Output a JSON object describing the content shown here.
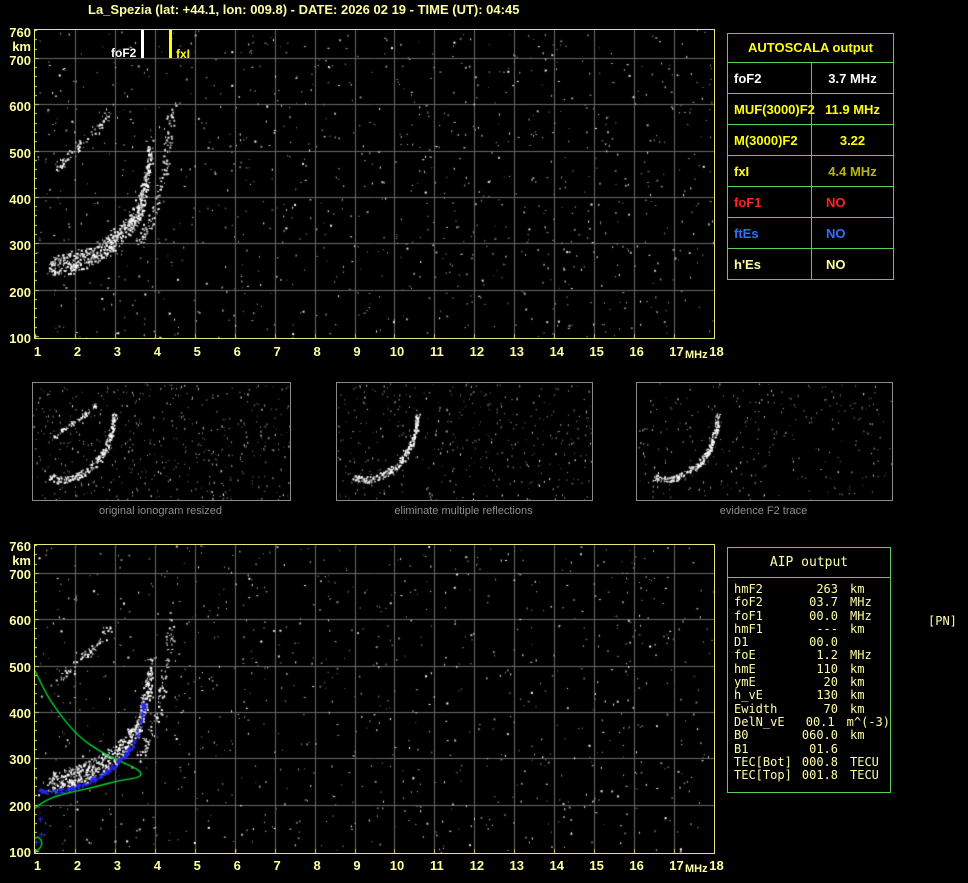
{
  "title": "La_Spezia (lat: +44.1, lon: 009.8) - DATE: 2026 02 19 - TIME (UT): 04:45",
  "colors": {
    "pale_yellow": "#ffffa0",
    "bright_yellow": "#ffff00",
    "olive": "#b8b800",
    "red": "#ff2222",
    "blue": "#2a72ff",
    "white": "#ffffff",
    "grid": "#686868",
    "plot_border": "#e6e67a",
    "table_green": "#58d058",
    "caption_gray": "#8f8f8f",
    "profile_green": "#00d435",
    "trace_blue": "#2626f5"
  },
  "axes": {
    "y_labels": [
      "760",
      "km",
      "700",
      "600",
      "500",
      "400",
      "300",
      "200",
      "100"
    ],
    "x_ticks": [
      "1",
      "2",
      "3",
      "4",
      "5",
      "6",
      "7",
      "8",
      "9",
      "10",
      "11",
      "12",
      "13",
      "14",
      "15",
      "16",
      "17",
      "18"
    ],
    "x_unit": "MHz"
  },
  "autoscala": {
    "header": "AUTOSCALA output",
    "rows": [
      {
        "label": "foF2",
        "value": "3.7 MHz",
        "label_color": "#ffffff",
        "value_color": "#ffffff"
      },
      {
        "label": "MUF(3000)F2",
        "value": "11.9 MHz",
        "label_color": "#ffff00",
        "value_color": "#ffff00"
      },
      {
        "label": "M(3000)F2",
        "value": "3.22",
        "label_color": "#ffff00",
        "value_color": "#ffff00"
      },
      {
        "label": "fxI",
        "value": "4.4 MHz",
        "label_color": "#ffff00",
        "value_color": "#b8b800"
      },
      {
        "label": "foF1",
        "value": "NO",
        "label_color": "#ff2222",
        "value_color": "#ff2222"
      },
      {
        "label": "ftEs",
        "value": "NO",
        "label_color": "#2a72ff",
        "value_color": "#2a72ff"
      },
      {
        "label": "h'Es",
        "value": "NO",
        "label_color": "#ffffa0",
        "value_color": "#ffffa0"
      }
    ]
  },
  "aip": {
    "header": "AIP output",
    "pn_note": "[PN]",
    "rows": [
      {
        "label": "hmF2",
        "value": "263",
        "unit": "km"
      },
      {
        "label": "foF2",
        "value": "03.7",
        "unit": "MHz"
      },
      {
        "label": "foF1",
        "value": "00.0",
        "unit": "MHz"
      },
      {
        "label": "hmF1",
        "value": "---",
        "unit": "km"
      },
      {
        "label": "D1",
        "value": "00.0",
        "unit": ""
      },
      {
        "label": "foE",
        "value": "1.2",
        "unit": "MHz"
      },
      {
        "label": "hmE",
        "value": "110",
        "unit": "km"
      },
      {
        "label": "ymE",
        "value": "20",
        "unit": "km"
      },
      {
        "label": "h_vE",
        "value": "130",
        "unit": "km"
      },
      {
        "label": "Ewidth",
        "value": "70",
        "unit": "km"
      },
      {
        "label": "DelN_vE",
        "value": "00.1",
        "unit": "m^(-3)"
      },
      {
        "label": "B0",
        "value": "060.0",
        "unit": "km"
      },
      {
        "label": "B1",
        "value": "01.6",
        "unit": ""
      },
      {
        "label": "TEC[Bot]",
        "value": "000.8",
        "unit": "TECU"
      },
      {
        "label": "TEC[Top]",
        "value": "001.8",
        "unit": "TECU"
      }
    ]
  },
  "thumbnails": [
    {
      "caption": "original ionogram resized",
      "seed": 11,
      "noise": 520,
      "second_hop": true
    },
    {
      "caption": "eliminate multiple reflections",
      "seed": 22,
      "noise": 430,
      "second_hop": false
    },
    {
      "caption": "evidence F2 trace",
      "seed": 33,
      "noise": 300,
      "second_hop": false
    }
  ],
  "chart_data": [
    {
      "name": "top_ionogram",
      "type": "scatter",
      "xlabel": "MHz",
      "ylabel": "km",
      "xlim": [
        1,
        18
      ],
      "ylim": [
        100,
        760
      ],
      "grid": true,
      "seed": 7,
      "noise_count": 1050,
      "markers": [
        {
          "label": "foF2",
          "freq_mhz": 3.7,
          "color": "#ffffff"
        },
        {
          "label": "fxI",
          "freq_mhz": 4.4,
          "color": "#ffff00"
        }
      ],
      "traces": [
        {
          "name": "F2-ordinary-echo",
          "n": 300,
          "jx": 3,
          "jy": 7,
          "offsets": [
            0,
            -10
          ],
          "color": "#ffffff",
          "points": [
            [
              1.35,
              238
            ],
            [
              1.6,
              242
            ],
            [
              1.85,
              247
            ],
            [
              2.1,
              254
            ],
            [
              2.35,
              263
            ],
            [
              2.6,
              274
            ],
            [
              2.85,
              288
            ],
            [
              3.05,
              302
            ],
            [
              3.25,
              318
            ],
            [
              3.45,
              340
            ],
            [
              3.6,
              365
            ],
            [
              3.72,
              400
            ],
            [
              3.82,
              445
            ],
            [
              3.9,
              495
            ]
          ]
        },
        {
          "name": "F2-extraordinary-echo",
          "n": 110,
          "jx": 4,
          "jy": 9,
          "offsets": [
            0
          ],
          "color": "#e8e8e8",
          "points": [
            [
              3.55,
              295
            ],
            [
              3.75,
              325
            ],
            [
              3.95,
              365
            ],
            [
              4.1,
              405
            ],
            [
              4.2,
              450
            ],
            [
              4.3,
              505
            ],
            [
              4.38,
              560
            ],
            [
              4.44,
              605
            ]
          ]
        },
        {
          "name": "second-hop-echo",
          "n": 80,
          "jx": 3,
          "jy": 6,
          "offsets": [
            0
          ],
          "color": "#ffffff",
          "points": [
            [
              1.5,
              462
            ],
            [
              1.75,
              482
            ],
            [
              2.0,
              503
            ],
            [
              2.3,
              527
            ],
            [
              2.6,
              553
            ],
            [
              2.85,
              582
            ]
          ]
        }
      ]
    },
    {
      "name": "bottom_ionogram",
      "type": "scatter",
      "xlabel": "MHz",
      "ylabel": "km",
      "xlim": [
        1,
        18
      ],
      "ylim": [
        100,
        760
      ],
      "grid": true,
      "seed": 19,
      "noise_count": 950,
      "traces": [
        {
          "name": "F2-ordinary-echo",
          "n": 280,
          "jx": 3,
          "jy": 7,
          "offsets": [
            0,
            -10
          ],
          "color": "#ffffff",
          "points": [
            [
              1.35,
              238
            ],
            [
              1.6,
              242
            ],
            [
              1.85,
              247
            ],
            [
              2.1,
              254
            ],
            [
              2.35,
              263
            ],
            [
              2.6,
              274
            ],
            [
              2.85,
              288
            ],
            [
              3.05,
              302
            ],
            [
              3.25,
              318
            ],
            [
              3.45,
              340
            ],
            [
              3.6,
              365
            ],
            [
              3.72,
              400
            ],
            [
              3.82,
              445
            ],
            [
              3.9,
              495
            ]
          ]
        },
        {
          "name": "F2-extraordinary-echo",
          "n": 100,
          "jx": 4,
          "jy": 9,
          "offsets": [
            0
          ],
          "color": "#e8e8e8",
          "points": [
            [
              3.55,
              295
            ],
            [
              3.75,
              325
            ],
            [
              3.95,
              365
            ],
            [
              4.1,
              405
            ],
            [
              4.2,
              450
            ],
            [
              4.3,
              505
            ],
            [
              4.38,
              560
            ],
            [
              4.44,
              605
            ]
          ]
        },
        {
          "name": "second-hop-echo",
          "n": 70,
          "jx": 3,
          "jy": 6,
          "offsets": [
            0
          ],
          "color": "#ffffff",
          "points": [
            [
              1.5,
              462
            ],
            [
              1.75,
              482
            ],
            [
              2.0,
              503
            ],
            [
              2.3,
              527
            ],
            [
              2.6,
              553
            ],
            [
              2.85,
              582
            ]
          ]
        }
      ],
      "profile_lines": [
        {
          "name": "electron-density-profile-F",
          "points": [
            [
              0.9,
              508
            ],
            [
              1.2,
              450
            ],
            [
              1.6,
              396
            ],
            [
              2.1,
              346
            ],
            [
              2.6,
              316
            ],
            [
              3.1,
              294
            ],
            [
              3.5,
              280
            ],
            [
              3.68,
              268
            ],
            [
              3.6,
              258
            ],
            [
              3.1,
              252
            ],
            [
              2.5,
              238
            ],
            [
              1.95,
              228
            ],
            [
              1.45,
              217
            ],
            [
              1.1,
              200
            ],
            [
              0.92,
              186
            ]
          ]
        },
        {
          "name": "electron-density-profile-E",
          "points": [
            [
              0.95,
              100
            ],
            [
              0.9,
              112
            ],
            [
              0.95,
              124
            ],
            [
              1.05,
              131
            ],
            [
              1.15,
              126
            ],
            [
              1.18,
              114
            ],
            [
              1.1,
              103
            ],
            [
              0.98,
              100
            ]
          ]
        }
      ],
      "restored_trace": {
        "name": "autoscala-restored-trace",
        "points": [
          [
            1.1,
            232
          ],
          [
            1.35,
            228
          ],
          [
            1.6,
            230
          ],
          [
            1.85,
            235
          ],
          [
            2.1,
            242
          ],
          [
            2.35,
            251
          ],
          [
            2.6,
            262
          ],
          [
            2.8,
            273
          ],
          [
            3.0,
            287
          ],
          [
            3.2,
            303
          ],
          [
            3.35,
            318
          ],
          [
            3.5,
            338
          ],
          [
            3.6,
            362
          ],
          [
            3.68,
            395
          ],
          [
            3.72,
            420
          ]
        ],
        "stray_points": [
          [
            1.12,
            170
          ],
          [
            1.15,
            137
          ],
          [
            1.02,
            120
          ]
        ]
      }
    },
    {
      "name": "thumbnail_trace_shape",
      "type": "scatter",
      "main": [
        [
          0.065,
          0.8
        ],
        [
          0.1,
          0.825
        ],
        [
          0.145,
          0.815
        ],
        [
          0.185,
          0.78
        ],
        [
          0.225,
          0.72
        ],
        [
          0.26,
          0.64
        ],
        [
          0.285,
          0.55
        ],
        [
          0.3,
          0.45
        ],
        [
          0.31,
          0.36
        ],
        [
          0.315,
          0.28
        ]
      ],
      "hop": [
        [
          0.075,
          0.47
        ],
        [
          0.13,
          0.38
        ],
        [
          0.19,
          0.28
        ],
        [
          0.245,
          0.18
        ]
      ]
    }
  ]
}
